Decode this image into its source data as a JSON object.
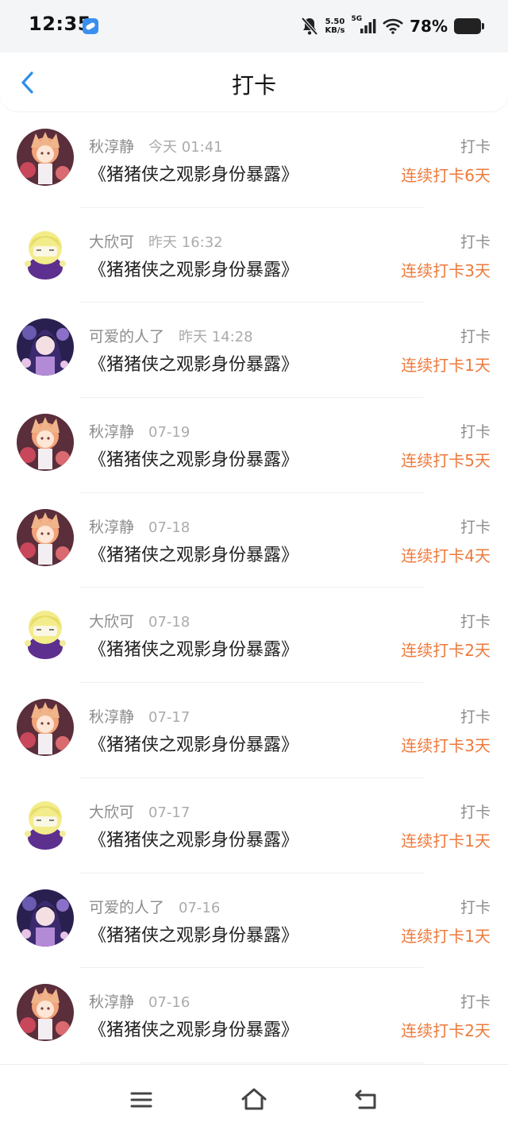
{
  "status_bar": {
    "time": "12:35",
    "net_speed_value": "5.50",
    "net_speed_unit": "KB/s",
    "network_type": "5G",
    "battery": "78%",
    "icons": [
      "app-badge-icon",
      "bell-muted-icon",
      "signal-icon",
      "wifi-icon",
      "battery-icon"
    ]
  },
  "header": {
    "title": "打卡",
    "back_icon": "chevron-left-icon"
  },
  "records": [
    {
      "user": "秋淳静",
      "time": "今天 01:41",
      "book": "《猪猪侠之观影身份暴露》",
      "type": "打卡",
      "streak": "连续打卡6天",
      "avatar": "A"
    },
    {
      "user": "大欣可",
      "time": "昨天 16:32",
      "book": "《猪猪侠之观影身份暴露》",
      "type": "打卡",
      "streak": "连续打卡3天",
      "avatar": "B"
    },
    {
      "user": "可爱的人了",
      "time": "昨天 14:28",
      "book": "《猪猪侠之观影身份暴露》",
      "type": "打卡",
      "streak": "连续打卡1天",
      "avatar": "C"
    },
    {
      "user": "秋淳静",
      "time": "07-19",
      "book": "《猪猪侠之观影身份暴露》",
      "type": "打卡",
      "streak": "连续打卡5天",
      "avatar": "A"
    },
    {
      "user": "秋淳静",
      "time": "07-18",
      "book": "《猪猪侠之观影身份暴露》",
      "type": "打卡",
      "streak": "连续打卡4天",
      "avatar": "A"
    },
    {
      "user": "大欣可",
      "time": "07-18",
      "book": "《猪猪侠之观影身份暴露》",
      "type": "打卡",
      "streak": "连续打卡2天",
      "avatar": "B"
    },
    {
      "user": "秋淳静",
      "time": "07-17",
      "book": "《猪猪侠之观影身份暴露》",
      "type": "打卡",
      "streak": "连续打卡3天",
      "avatar": "A"
    },
    {
      "user": "大欣可",
      "time": "07-17",
      "book": "《猪猪侠之观影身份暴露》",
      "type": "打卡",
      "streak": "连续打卡1天",
      "avatar": "B"
    },
    {
      "user": "可爱的人了",
      "time": "07-16",
      "book": "《猪猪侠之观影身份暴露》",
      "type": "打卡",
      "streak": "连续打卡1天",
      "avatar": "C"
    },
    {
      "user": "秋淳静",
      "time": "07-16",
      "book": "《猪猪侠之观影身份暴露》",
      "type": "打卡",
      "streak": "连续打卡2天",
      "avatar": "A"
    }
  ],
  "bottom_nav": {
    "icons": [
      "menu-icon",
      "home-icon",
      "back-icon"
    ]
  },
  "colors": {
    "streak": "#ee7a3c",
    "accent": "#2f8fe8",
    "muted": "#8c8c8c"
  }
}
